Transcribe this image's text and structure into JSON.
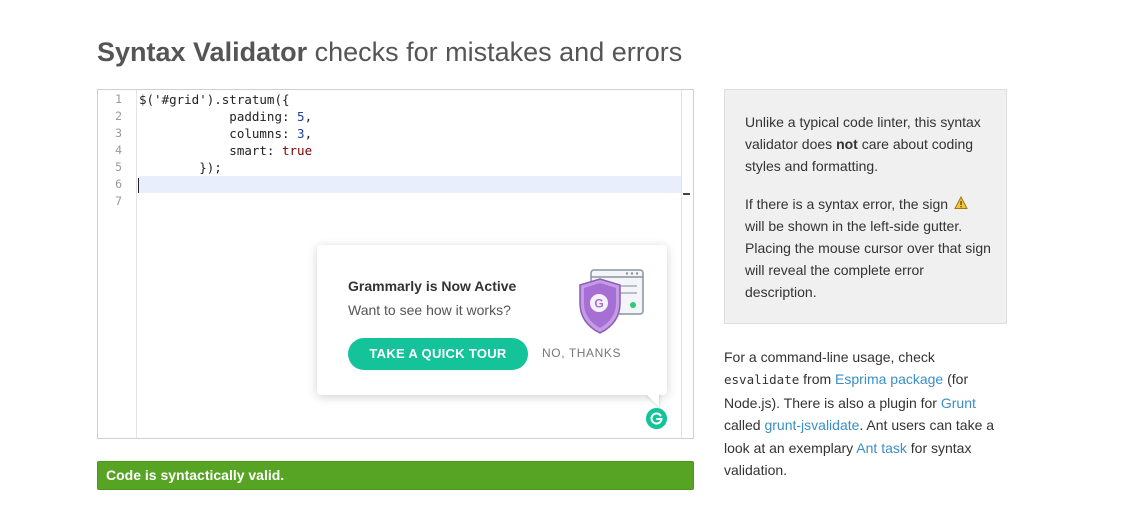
{
  "header": {
    "title_bold": "Syntax Validator",
    "title_rest": " checks for mistakes and errors"
  },
  "editor": {
    "line_numbers": [
      "1",
      "2",
      "3",
      "4",
      "5",
      "6",
      "7"
    ],
    "lines": [
      [
        {
          "t": "$('#grid').stratum({",
          "c": ""
        }
      ],
      [
        {
          "t": "            padding: ",
          "c": ""
        },
        {
          "t": "5",
          "c": "num"
        },
        {
          "t": ",",
          "c": ""
        }
      ],
      [
        {
          "t": "            columns: ",
          "c": ""
        },
        {
          "t": "3",
          "c": "num"
        },
        {
          "t": ",",
          "c": ""
        }
      ],
      [
        {
          "t": "            smart: ",
          "c": ""
        },
        {
          "t": "true",
          "c": "kw"
        }
      ],
      [
        {
          "t": "        });",
          "c": ""
        }
      ],
      [],
      []
    ],
    "active_line": 6
  },
  "grammarly": {
    "title": "Grammarly is Now Active",
    "subtitle": "Want to see how it works?",
    "tour_button": "TAKE A QUICK TOUR",
    "dismiss": "NO, THANKS",
    "logo_letter": "G",
    "colors": {
      "brand": "#15c39a",
      "shield": "#b07ad9"
    }
  },
  "status": {
    "text": "Code is syntactically valid.",
    "color": "#57a324"
  },
  "info": {
    "p1_a": "Unlike a typical code linter, this syntax validator does ",
    "p1_bold": "not",
    "p1_b": " care about coding styles and formatting.",
    "p2_a": "If there is a syntax error, the sign",
    "p2_b": "will be shown in the left-side gutter. Placing the mouse cursor over that sign will reveal the complete error description."
  },
  "usage": {
    "t1": "For a command-line usage, check ",
    "code1": "esvalidate",
    "t2": " from ",
    "link1": "Esprima package",
    "t3": " (for Node.js). There is also a plugin for ",
    "link2": "Grunt",
    "t4": " called ",
    "link3": "grunt-jsvalidate",
    "t5": ". Ant users can take a look at an exemplary ",
    "link4": "Ant task",
    "t6": " for syntax validation.",
    "link_color": "#3a8fc7"
  }
}
